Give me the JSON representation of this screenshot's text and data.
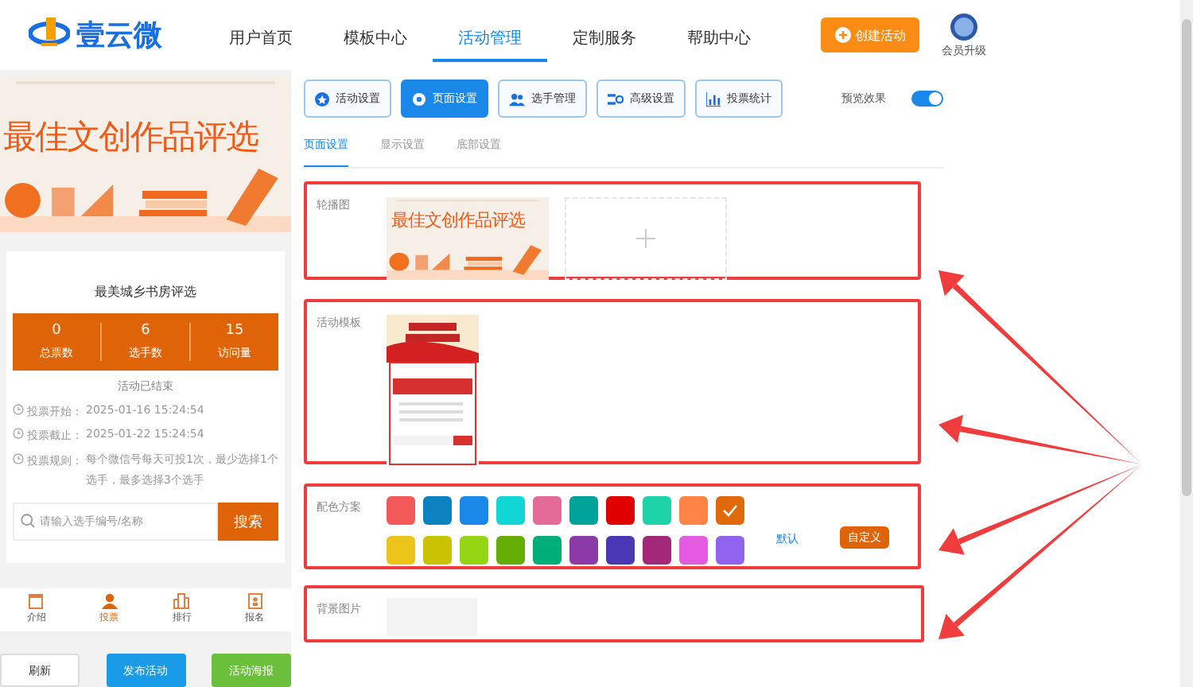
{
  "brand": {
    "name": "壹云微"
  },
  "nav": [
    {
      "label": "用户首页",
      "selected": false
    },
    {
      "label": "模板中心",
      "selected": false
    },
    {
      "label": "活动管理",
      "selected": true
    },
    {
      "label": "定制服务",
      "selected": false
    },
    {
      "label": "帮助中心",
      "selected": false
    }
  ],
  "create_button": "创建活动",
  "vip": {
    "label": "会员升级"
  },
  "preview": {
    "banner_title": "最佳文创作品评选",
    "title": "最美城乡书房评选",
    "stats": [
      {
        "value": "0",
        "label": "总票数"
      },
      {
        "value": "6",
        "label": "选手数"
      },
      {
        "value": "15",
        "label": "访问量"
      }
    ],
    "status": "活动已结束",
    "info": [
      {
        "label": "投票开始：",
        "value": "2025-01-16 15:24:54"
      },
      {
        "label": "投票截止：",
        "value": "2025-01-22 15:24:54"
      },
      {
        "label": "投票规则：",
        "value": "每个微信号每天可投1次，最少选择1个选手，最多选择3个选手"
      }
    ],
    "search": {
      "placeholder": "请输入选手编号/名称",
      "button": "搜索"
    },
    "tabbar": [
      {
        "label": "介绍",
        "selected": false
      },
      {
        "label": "投票",
        "selected": true
      },
      {
        "label": "排行",
        "selected": false
      },
      {
        "label": "报名",
        "selected": false
      }
    ],
    "actions": [
      {
        "label": "刷新",
        "kind": "plain"
      },
      {
        "label": "发布活动",
        "kind": "primary"
      },
      {
        "label": "活动海报",
        "kind": "success"
      }
    ]
  },
  "toolbar": [
    {
      "label": "活动设置",
      "selected": false
    },
    {
      "label": "页面设置",
      "selected": true
    },
    {
      "label": "选手管理",
      "selected": false
    },
    {
      "label": "高级设置",
      "selected": false
    },
    {
      "label": "投票统计",
      "selected": false
    }
  ],
  "preview_toggle": {
    "label": "预览效果",
    "on": true
  },
  "subtabs": [
    {
      "label": "页面设置",
      "selected": true
    },
    {
      "label": "显示设置",
      "selected": false
    },
    {
      "label": "底部设置",
      "selected": false
    }
  ],
  "carousel": {
    "label": "轮播图",
    "image_title": "最佳文创作品评选"
  },
  "template": {
    "label": "活动模板"
  },
  "colors": {
    "label": "配色方案",
    "default_link": "默认",
    "custom_button": "自定义",
    "swatches": [
      {
        "color": "#f25a5a",
        "selected": false
      },
      {
        "color": "#0c82c0",
        "selected": false
      },
      {
        "color": "#1a88e8",
        "selected": false
      },
      {
        "color": "#12d6d6",
        "selected": false
      },
      {
        "color": "#e46a98",
        "selected": false
      },
      {
        "color": "#00a39a",
        "selected": false
      },
      {
        "color": "#e00000",
        "selected": false
      },
      {
        "color": "#1dd3a7",
        "selected": false
      },
      {
        "color": "#ff8446",
        "selected": false
      },
      {
        "color": "#e06a0a",
        "selected": true
      },
      {
        "color": "#edc41a",
        "selected": false
      },
      {
        "color": "#c8c200",
        "selected": false
      },
      {
        "color": "#94d613",
        "selected": false
      },
      {
        "color": "#64ad05",
        "selected": false
      },
      {
        "color": "#00ae7a",
        "selected": false
      },
      {
        "color": "#8b3aa8",
        "selected": false
      },
      {
        "color": "#4a37b5",
        "selected": false
      },
      {
        "color": "#a3287a",
        "selected": false
      },
      {
        "color": "#e45ae0",
        "selected": false
      },
      {
        "color": "#9263ee",
        "selected": false
      }
    ]
  },
  "background": {
    "label": "背景图片"
  }
}
